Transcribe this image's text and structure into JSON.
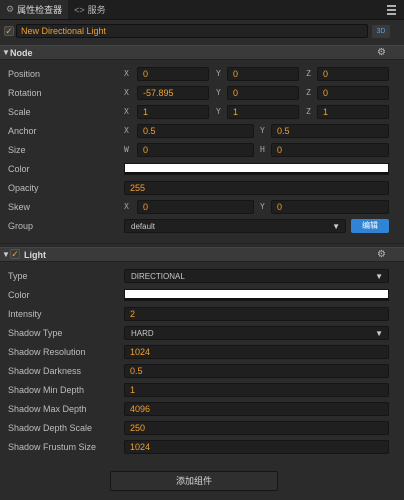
{
  "tabs": [
    {
      "label": "属性检查器",
      "icon": "gear-icon"
    },
    {
      "label": "服务",
      "icon": "code-icon"
    }
  ],
  "node_header": {
    "enabled": true,
    "name": "New Directional Light",
    "badge": "3D"
  },
  "node_section": {
    "title": "Node",
    "position": {
      "label": "Position",
      "x": "0",
      "y": "0",
      "z": "0"
    },
    "rotation": {
      "label": "Rotation",
      "x": "-57.895",
      "y": "0",
      "z": "0"
    },
    "scale": {
      "label": "Scale",
      "x": "1",
      "y": "1",
      "z": "1"
    },
    "anchor": {
      "label": "Anchor",
      "x": "0.5",
      "y": "0.5"
    },
    "size": {
      "label": "Size",
      "w": "0",
      "h": "0"
    },
    "color": {
      "label": "Color",
      "value": "#ffffff"
    },
    "opacity": {
      "label": "Opacity",
      "value": "255"
    },
    "skew": {
      "label": "Skew",
      "x": "0",
      "y": "0"
    },
    "group": {
      "label": "Group",
      "value": "default",
      "edit_label": "编辑"
    }
  },
  "axis_labels": {
    "x": "X",
    "y": "Y",
    "z": "Z",
    "w": "W",
    "h": "H"
  },
  "light_section": {
    "title": "Light",
    "enabled": true,
    "type": {
      "label": "Type",
      "value": "DIRECTIONAL"
    },
    "color": {
      "label": "Color",
      "value": "#ffffff"
    },
    "intensity": {
      "label": "Intensity",
      "value": "2"
    },
    "shadow_type": {
      "label": "Shadow Type",
      "value": "HARD"
    },
    "shadow_resolution": {
      "label": "Shadow Resolution",
      "value": "1024"
    },
    "shadow_darkness": {
      "label": "Shadow Darkness",
      "value": "0.5"
    },
    "shadow_min_depth": {
      "label": "Shadow Min Depth",
      "value": "1"
    },
    "shadow_max_depth": {
      "label": "Shadow Max Depth",
      "value": "4096"
    },
    "shadow_depth_scale": {
      "label": "Shadow Depth Scale",
      "value": "250"
    },
    "shadow_frustum_size": {
      "label": "Shadow Frustum Size",
      "value": "1024"
    }
  },
  "add_component_label": "添加组件",
  "colors": {
    "accent": "#f0a030",
    "button": "#2f84d6",
    "badge": "#5fa0e8"
  }
}
